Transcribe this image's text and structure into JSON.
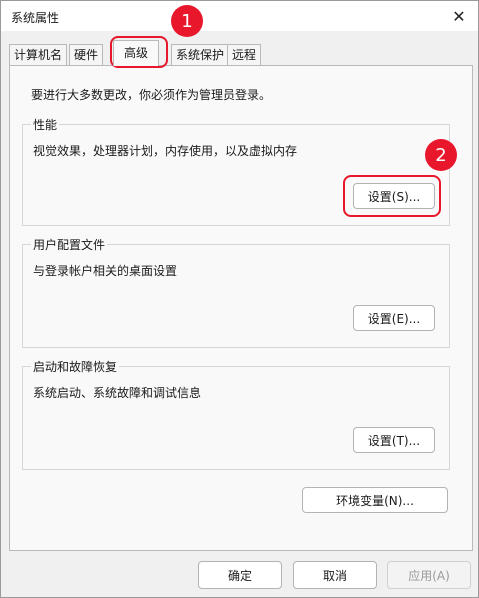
{
  "window": {
    "title": "系统属性"
  },
  "tabs": [
    {
      "label": "计算机名"
    },
    {
      "label": "硬件"
    },
    {
      "label": "高级"
    },
    {
      "label": "系统保护"
    },
    {
      "label": "远程"
    }
  ],
  "panel": {
    "notice": "要进行大多数更改，你必须作为管理员登录。",
    "performance": {
      "title": "性能",
      "desc": "视觉效果，处理器计划，内存使用，以及虚拟内存",
      "button": "设置(S)..."
    },
    "user_profile": {
      "title": "用户配置文件",
      "desc": "与登录帐户相关的桌面设置",
      "button": "设置(E)..."
    },
    "startup": {
      "title": "启动和故障恢复",
      "desc": "系统启动、系统故障和调试信息",
      "button": "设置(T)..."
    },
    "env_button": "环境变量(N)..."
  },
  "footer": {
    "ok": "确定",
    "cancel": "取消",
    "apply": "应用(A)"
  },
  "annotations": {
    "step1": "1",
    "step2": "2",
    "color": "#e8172c"
  }
}
